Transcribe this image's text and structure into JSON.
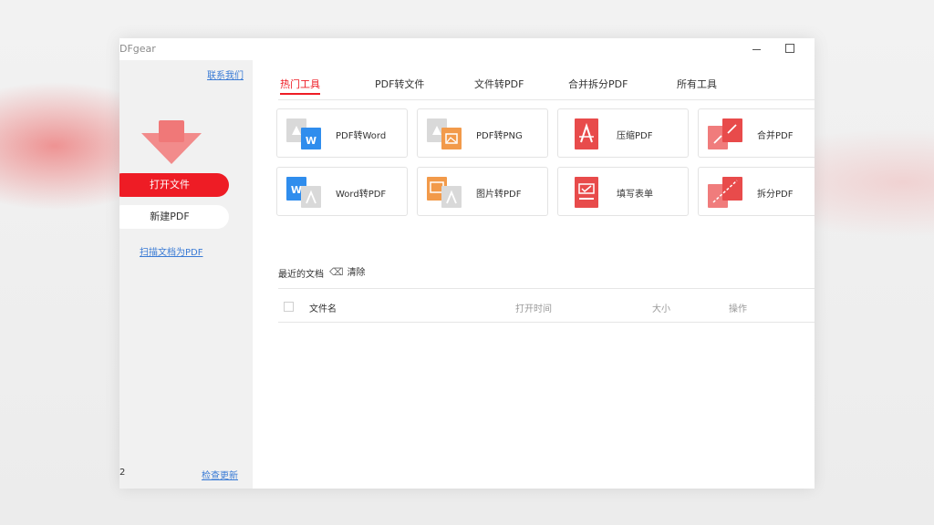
{
  "window": {
    "title": "DFgear"
  },
  "sidebar": {
    "contact": "联系我们",
    "open_file": "打开文件",
    "new_pdf": "新建PDF",
    "scan_to_pdf": "扫描文档为PDF",
    "version": "2",
    "check_update": "检查更新"
  },
  "tabs": [
    "热门工具",
    "PDF转文件",
    "文件转PDF",
    "合并拆分PDF",
    "所有工具"
  ],
  "tools": [
    {
      "label": "PDF转Word",
      "icon": "pdf-to-word-icon"
    },
    {
      "label": "PDF转PNG",
      "icon": "pdf-to-png-icon"
    },
    {
      "label": "压缩PDF",
      "icon": "compress-pdf-icon"
    },
    {
      "label": "合并PDF",
      "icon": "merge-pdf-icon"
    },
    {
      "label": "Word转PDF",
      "icon": "word-to-pdf-icon"
    },
    {
      "label": "图片转PDF",
      "icon": "image-to-pdf-icon"
    },
    {
      "label": "填写表单",
      "icon": "fill-form-icon"
    },
    {
      "label": "拆分PDF",
      "icon": "split-pdf-icon"
    }
  ],
  "recent": {
    "title": "最近的文档",
    "clear": "清除",
    "columns": {
      "name": "文件名",
      "opened": "打开时间",
      "size": "大小",
      "action": "操作"
    }
  },
  "colors": {
    "accent": "#ee1c25",
    "link": "#3a7bd5",
    "word_blue": "#2f8ded",
    "orange": "#f29a4a"
  }
}
